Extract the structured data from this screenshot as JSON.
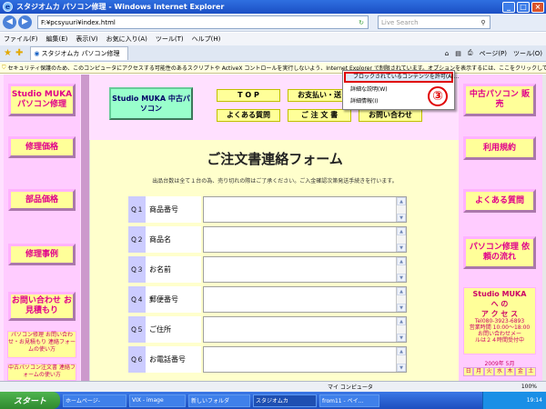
{
  "window": {
    "title": "スタジオムカ パソコン修理 - Windows Internet Explorer"
  },
  "browser": {
    "address": "F:¥pcsyuuri¥index.html",
    "search_placeholder": "Live Search",
    "menu": [
      "ファイル(F)",
      "編集(E)",
      "表示(V)",
      "お気に入り(A)",
      "ツール(T)",
      "ヘルプ(H)"
    ],
    "tab_label": "スタジオムカ パソコン修理",
    "tools": {
      "page": "ページ(P)",
      "tool": "ツール(O)"
    },
    "infobar": "セキュリティ保護のため、このコンピュータにアクセスする可能性のあるスクリプトや ActiveX コントロールを実行しないよう、Internet Explorer で制限されています。オプションを表示するには、ここをクリックしてください...",
    "zone": "マイ コンピュータ",
    "zoom": "100%"
  },
  "context_menu": {
    "items": [
      "ブロックされているコンテンツを許可(A)...",
      "詳細な説明(W)",
      "詳細情報(I)"
    ],
    "badge": "③"
  },
  "left_nav": {
    "items": [
      "Studio MUKA パソコン修理",
      "修理価格",
      "部品価格",
      "修理事例",
      "お問い合わせ お見積もり"
    ],
    "note1": "パソコン修理 お問い合わせ・お見積もり 連絡フォームの使い方",
    "note2": "中古パソコン注文書 連絡フォームの使い方"
  },
  "header": {
    "logo": "Studio MUKA 中古パソコン",
    "nav": [
      "T O P",
      "お支払い・送",
      "よくある質問",
      "ご 注 文 書",
      "お問い合わせ"
    ]
  },
  "right_nav": {
    "items": [
      "中古パソコン 販 売",
      "利用規約",
      "よくある質問",
      "パソコン修理 依頼の流れ"
    ],
    "contact": {
      "brand1": "Studio MUKA",
      "brand2": "へ の",
      "brand3": "ア ク セ ス",
      "tel": "Tel080-3923-6893",
      "hours": "営業時間 10:00～18:00",
      "mail": "お問い合わせメー",
      "note": "ルは２４時間受付中"
    },
    "calendar_title": "2009年 5月",
    "calendar_days": [
      "日",
      "月",
      "火",
      "水",
      "木",
      "金",
      "土"
    ]
  },
  "form": {
    "title": "ご注文書連絡フォーム",
    "intro": "出品台数は全て１台の為、売り切れの際はご了承ください。ご入金確認次第発送手続きを行います。",
    "rows": [
      {
        "q": "Ｑ１",
        "label": "商品番号"
      },
      {
        "q": "Ｑ２",
        "label": "商品名"
      },
      {
        "q": "Ｑ３",
        "label": "お名前"
      },
      {
        "q": "Ｑ４",
        "label": "郵便番号"
      },
      {
        "q": "Ｑ５",
        "label": "ご住所"
      },
      {
        "q": "Ｑ６",
        "label": "お電話番号"
      }
    ]
  },
  "taskbar": {
    "start": "スタート",
    "tasks": [
      "ホームページ-",
      "VIX - image",
      "新しいフォルダ",
      "スタジオムカ",
      "from11 - ペイ..."
    ],
    "clock": "19:14"
  }
}
